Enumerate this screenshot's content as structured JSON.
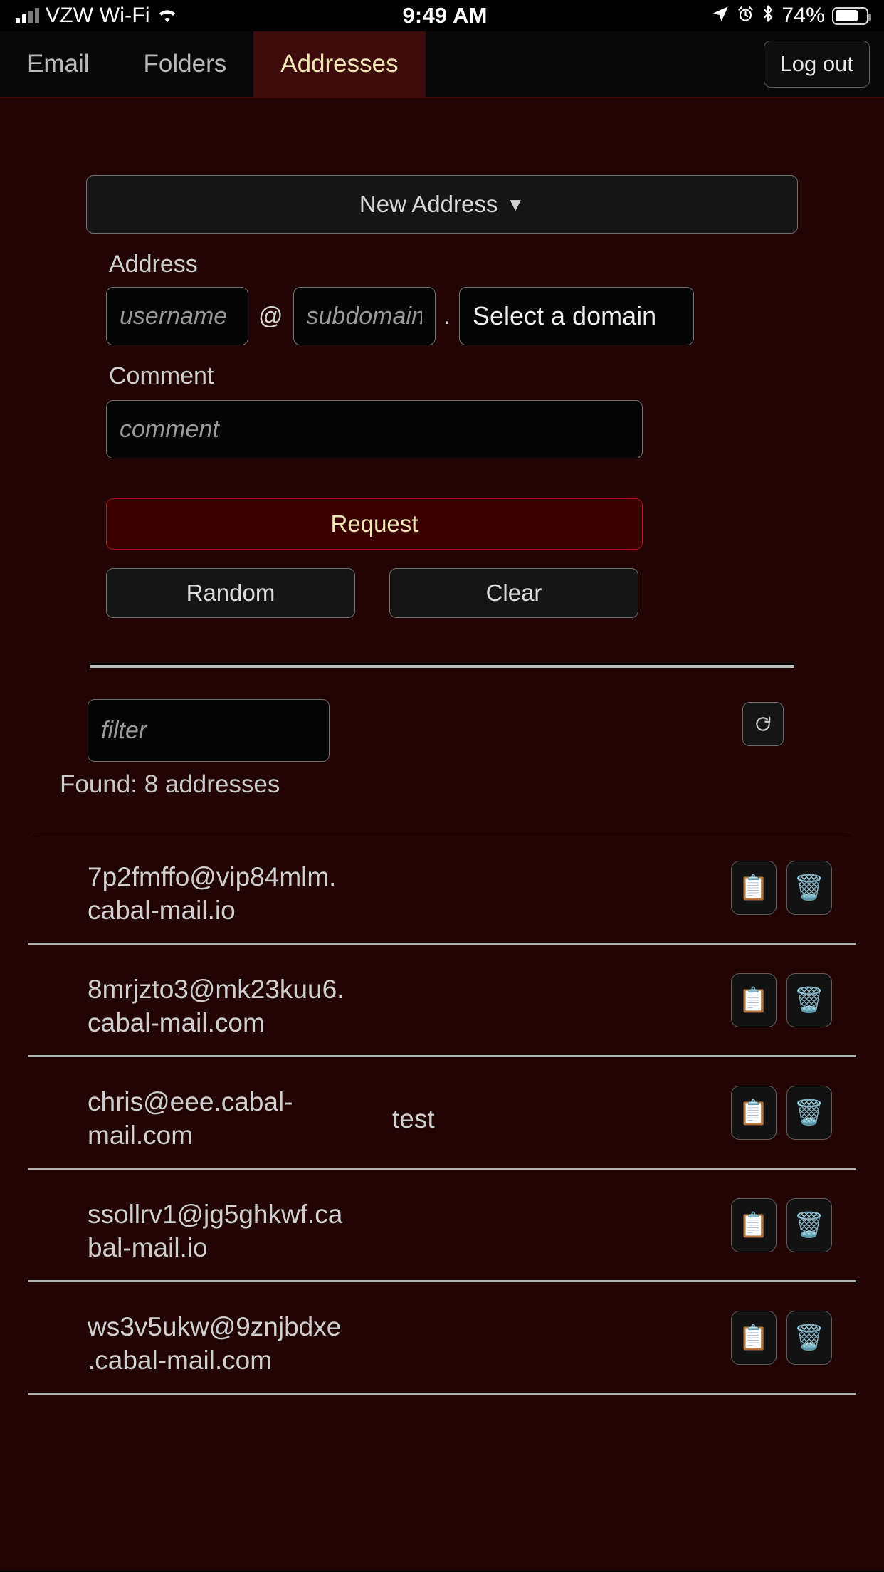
{
  "status_bar": {
    "carrier": "VZW Wi-Fi",
    "time": "9:49 AM",
    "battery_percent": "74%",
    "icons": [
      "signal-bars-icon",
      "wifi-icon",
      "location-arrow-icon",
      "alarm-clock-icon",
      "bluetooth-icon",
      "battery-icon"
    ]
  },
  "tabs": [
    {
      "label": "Email",
      "active": false
    },
    {
      "label": "Folders",
      "active": false
    },
    {
      "label": "Addresses",
      "active": true
    }
  ],
  "logout_label": "Log out",
  "form": {
    "mode_select_label": "New Address",
    "mode_select_caret": "▼",
    "address_label": "Address",
    "username_placeholder": "username",
    "at_symbol": "@",
    "subdomain_placeholder": "subdomain",
    "dot_symbol": ".",
    "domain_select_label": "Select a domain",
    "comment_label": "Comment",
    "comment_placeholder": "comment",
    "request_label": "Request",
    "random_label": "Random",
    "clear_label": "Clear"
  },
  "list_controls": {
    "filter_placeholder": "filter",
    "refresh_icon": "refresh-icon",
    "found_text": "Found: 8 addresses"
  },
  "addresses": [
    {
      "address": "7p2fmffo@vip84mlm.cabal-mail.io",
      "comment": "",
      "copy_icon": "📋",
      "delete_icon": "🗑️"
    },
    {
      "address": "8mrjzto3@mk23kuu6.cabal-mail.com",
      "comment": "",
      "copy_icon": "📋",
      "delete_icon": "🗑️"
    },
    {
      "address": "chris@eee.cabal-mail.com",
      "comment": "test",
      "copy_icon": "📋",
      "delete_icon": "🗑️"
    },
    {
      "address": "ssollrv1@jg5ghkwf.cabal-mail.io",
      "comment": "",
      "copy_icon": "📋",
      "delete_icon": "🗑️"
    },
    {
      "address": "ws3v5ukw@9znjbdxe.cabal-mail.com",
      "comment": "",
      "copy_icon": "📋",
      "delete_icon": "🗑️"
    }
  ],
  "colors": {
    "page_bg": "#230404",
    "tab_active_bg": "#3d0b0b",
    "tab_active_text": "#f0e6b4",
    "request_border": "#a81414",
    "request_bg": "#3a0000",
    "request_text": "#f2e8b6"
  }
}
